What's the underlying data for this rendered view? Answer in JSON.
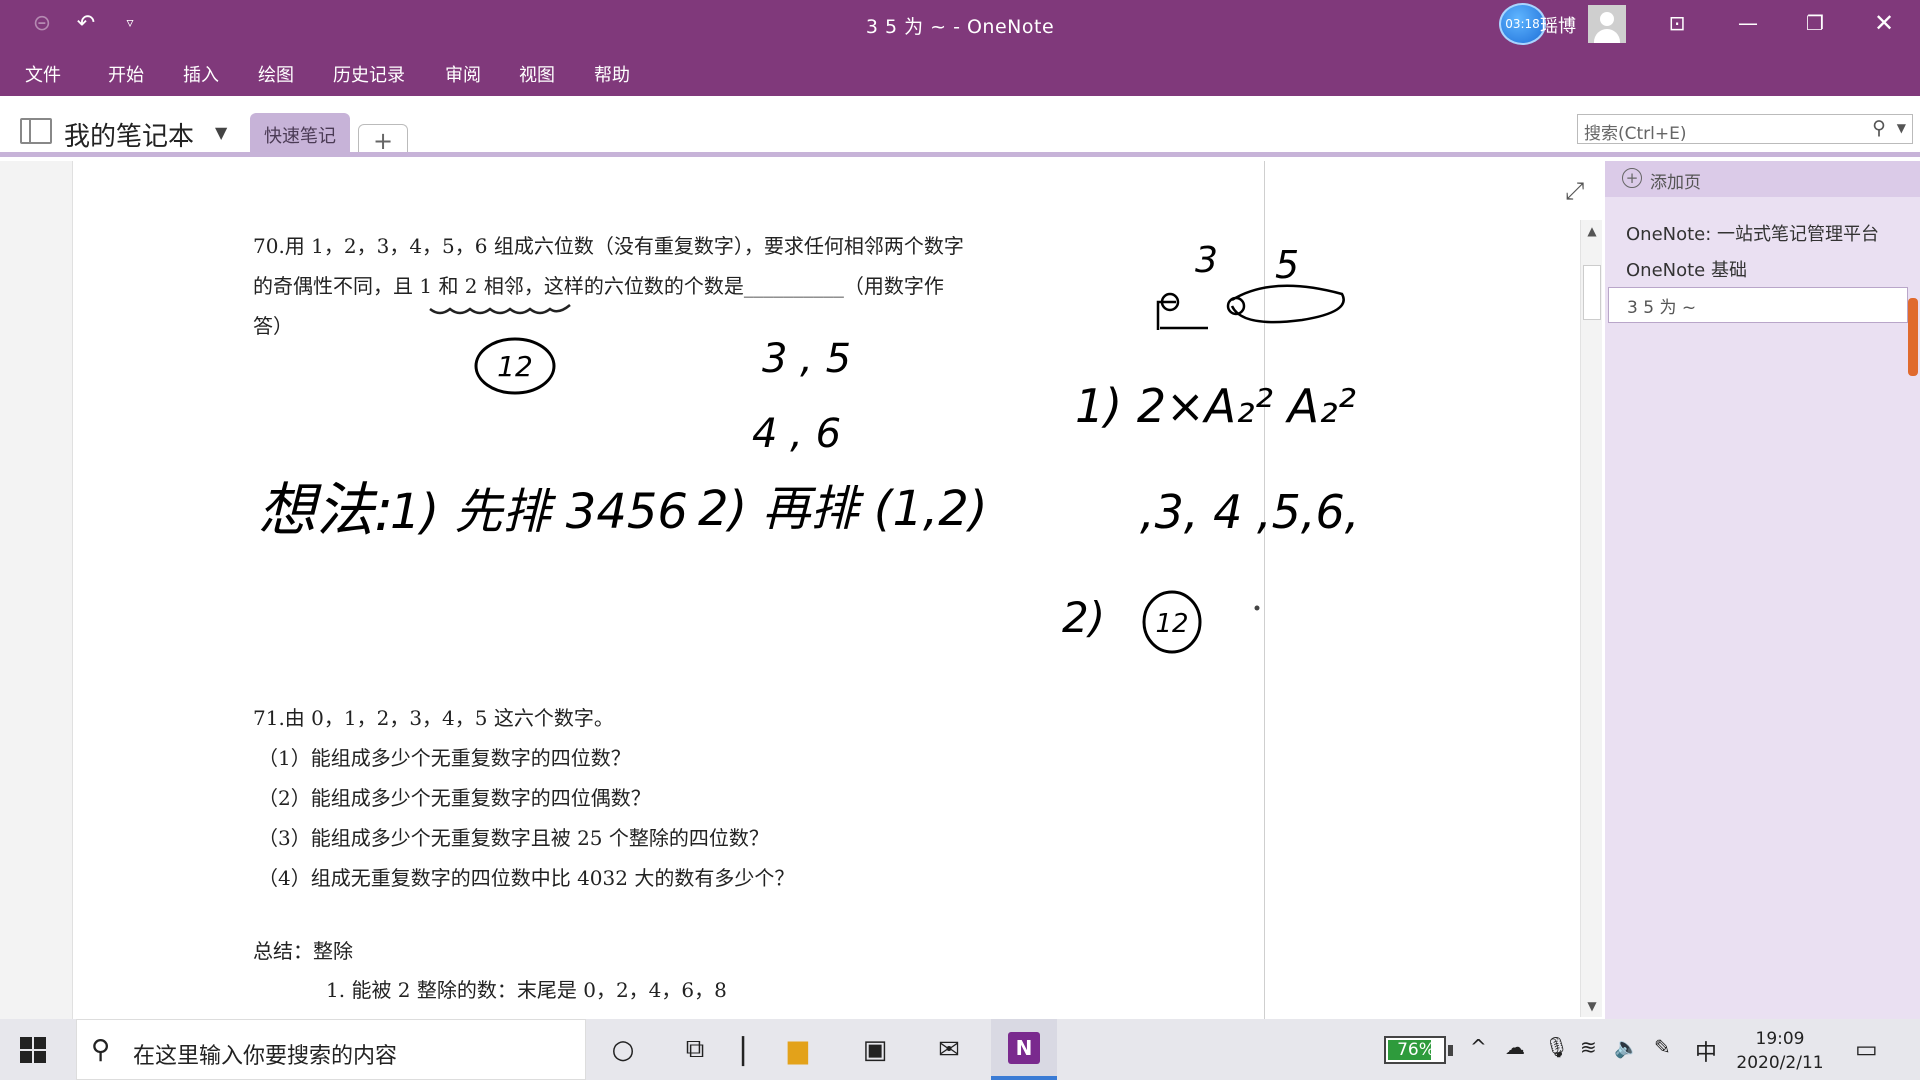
{
  "app": {
    "window_title": "3 5 为 ~  -  OneNote",
    "timer": "03:18",
    "user_name": "瑶博"
  },
  "quick_access": {
    "back_icon": "back-circle-icon",
    "undo_icon": "undo-icon",
    "customize_icon": "dropdown-icon"
  },
  "ribbon_tabs": [
    "文件",
    "开始",
    "插入",
    "绘图",
    "历史记录",
    "审阅",
    "视图",
    "帮助"
  ],
  "notebook": {
    "name": "我的笔记本",
    "section": "快速笔记",
    "add_section": "+",
    "search_placeholder": "搜索(Ctrl+E)"
  },
  "page_list": {
    "add_page": "添加页",
    "pages": [
      "OneNote: 一站式笔记管理平台",
      "OneNote 基础",
      "3 5 为 ~"
    ],
    "selected_index": 2
  },
  "document": {
    "problem70_lines": [
      "70.用 1，2，3，4，5，6 组成六位数（没有重复数字），要求任何相邻两个数字",
      "的奇偶性不同，且 1 和 2 相邻，这样的六位数的个数是__________（用数字作",
      "答）"
    ],
    "problem71_lines": [
      "71.由 0，1，2，3，4，5 这六个数字。",
      "（1）能组成多少个无重复数字的四位数？",
      "（2）能组成多少个无重复数字的四位偶数？",
      "（3）能组成多少个无重复数字且被 25 个整除的四位数？",
      "（4）组成无重复数字的四位数中比 4032 大的数有多少个？"
    ],
    "summary_title": "总结：整除",
    "summary_item_1": "1.  能被 2 整除的数：末尾是 0，2，4，6，8"
  },
  "ink": {
    "circled_12": "12",
    "odd_pair": "3 , 5",
    "even_pair": "4 , 6",
    "idea_label": "想法:",
    "step1": "1) 先排 3456",
    "step2": "2) 再排 (1,2)",
    "right_3": "3",
    "right_5": "5",
    "formula_step": "1)  2×A₂² A₂²",
    "sequence": ",3, 4 ,5,6,",
    "step_2_label": "2)",
    "circled_12_right": "12"
  },
  "taskbar": {
    "search_placeholder": "在这里输入你要搜索的内容",
    "battery_percent": "76%",
    "ime": "中",
    "time": "19:09",
    "date": "2020/2/11"
  },
  "colors": {
    "titlebar": "#80397b",
    "section_tab": "#c7b3d8",
    "page_pane": "#eae0f2",
    "battery_fill": "#2e9b3c",
    "scroll_accent": "#e06a2e"
  }
}
